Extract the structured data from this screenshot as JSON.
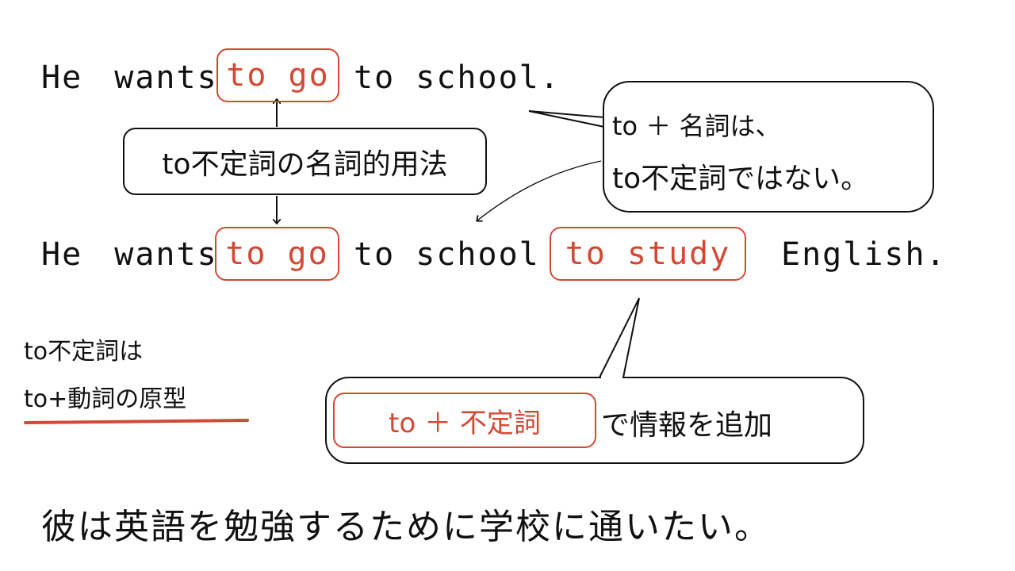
{
  "sentence1": {
    "subject": "He",
    "verb": "wants",
    "highlight": "to go",
    "rest": "to school."
  },
  "label_box": {
    "text": "to不定詞の名詞的用法"
  },
  "note_bubble": {
    "line1": "to ＋ 名詞は、",
    "line2": "to不定詞ではない。"
  },
  "sentence2": {
    "subject": "He",
    "verb": "wants",
    "highlight1": "to go",
    "middle": "to school",
    "highlight2": "to study",
    "end": "English."
  },
  "definition": {
    "line1": "to不定詞は",
    "line2": "to+動詞の原型"
  },
  "info_bubble": {
    "highlight": "to ＋ 不定詞",
    "text": "で情報を追加"
  },
  "translation": "彼は英語を勉強するために学校に通いたい。",
  "colors": {
    "accent_red": "#d24a35",
    "ink": "#111111",
    "background": "#ffffff"
  }
}
